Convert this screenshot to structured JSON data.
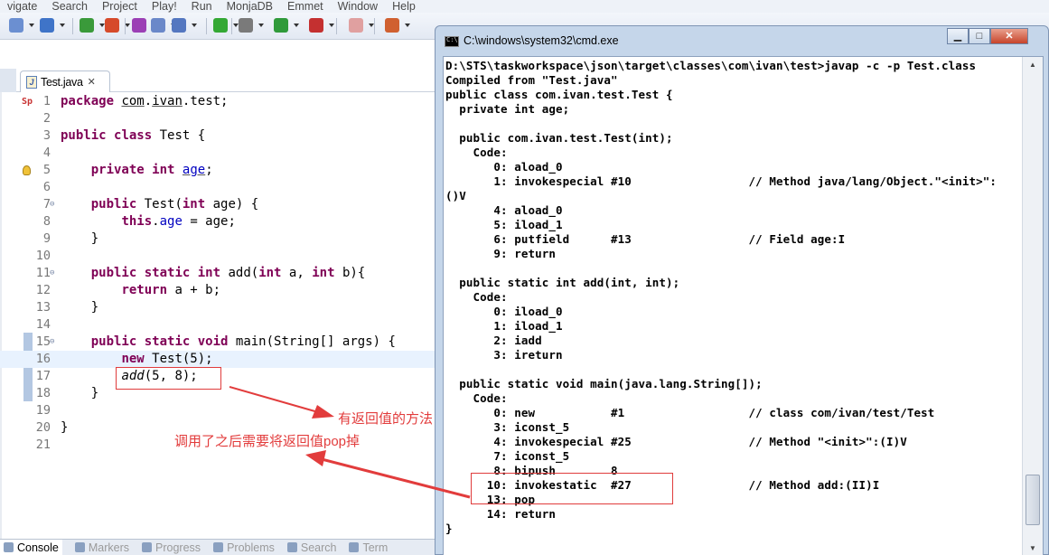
{
  "menu": [
    "vigate",
    "Search",
    "Project",
    "Play!",
    "Run",
    "MonjaDB",
    "Emmet",
    "Window",
    "Help"
  ],
  "editor": {
    "tab_label": "Test.java",
    "tab_close": "✕",
    "lines": [
      {
        "n": "1",
        "html": "<span class=\"kw\">package</span> <span class=\"ul\">com</span>.<span class=\"ul\">ivan</span>.test;"
      },
      {
        "n": "2",
        "html": ""
      },
      {
        "n": "3",
        "html": "<span class=\"kw\">public</span> <span class=\"kw\">class</span> Test {"
      },
      {
        "n": "4",
        "html": ""
      },
      {
        "n": "5",
        "html": "    <span class=\"kw\">private</span> <span class=\"kw\">int</span> <span class=\"fld ul\">age</span>;"
      },
      {
        "n": "6",
        "html": ""
      },
      {
        "n": "7",
        "html": "    <span class=\"kw\">public</span> Test(<span class=\"kw\">int</span> age) {"
      },
      {
        "n": "8",
        "html": "        <span class=\"kw\">this</span>.<span class=\"fld\">age</span> = age;"
      },
      {
        "n": "9",
        "html": "    }"
      },
      {
        "n": "10",
        "html": ""
      },
      {
        "n": "11",
        "html": "    <span class=\"kw\">public</span> <span class=\"kw\">static</span> <span class=\"kw\">int</span> add(<span class=\"kw\">int</span> a, <span class=\"kw\">int</span> b){"
      },
      {
        "n": "12",
        "html": "        <span class=\"kw\">return</span> a + b;"
      },
      {
        "n": "13",
        "html": "    }"
      },
      {
        "n": "14",
        "html": ""
      },
      {
        "n": "15",
        "html": "    <span class=\"kw\">public</span> <span class=\"kw\">static</span> <span class=\"kw\">void</span> main(String[] args) {"
      },
      {
        "n": "16",
        "html": "        <span class=\"kw\">new</span> Test(5);"
      },
      {
        "n": "17",
        "html": "        <span class=\"it\">add</span>(5, 8);"
      },
      {
        "n": "18",
        "html": "    }"
      },
      {
        "n": "19",
        "html": ""
      },
      {
        "n": "20",
        "html": "}"
      },
      {
        "n": "21",
        "html": ""
      }
    ],
    "marker_sp": "Sp"
  },
  "annotations": {
    "note_return": "有返回值的方法",
    "note_pop": "调用了之后需要将返回值pop掉",
    "accent_color": "#e23c3c"
  },
  "bottom_tabs": [
    "Console",
    "Markers",
    "Progress",
    "Problems",
    "Search",
    "Term"
  ],
  "cmd": {
    "title": "C:\\windows\\system32\\cmd.exe",
    "minimize": "▁",
    "maximize": "□",
    "close": "✕",
    "lines": [
      "D:\\STS\\taskworkspace\\json\\target\\classes\\com\\ivan\\test>javap -c -p Test.class",
      "Compiled from \"Test.java\"",
      "public class com.ivan.test.Test {",
      "  private int age;",
      "",
      "  public com.ivan.test.Test(int);",
      "    Code:",
      "       0: aload_0",
      "       1: invokespecial #10                 // Method java/lang/Object.\"<init>\":",
      "()V",
      "       4: aload_0",
      "       5: iload_1",
      "       6: putfield      #13                 // Field age:I",
      "       9: return",
      "",
      "  public static int add(int, int);",
      "    Code:",
      "       0: iload_0",
      "       1: iload_1",
      "       2: iadd",
      "       3: ireturn",
      "",
      "  public static void main(java.lang.String[]);",
      "    Code:",
      "       0: new           #1                  // class com/ivan/test/Test",
      "       3: iconst_5",
      "       4: invokespecial #25                 // Method \"<init>\":(I)V",
      "       7: iconst_5",
      "       8: bipush        8",
      "      10: invokestatic  #27                 // Method add:(II)I",
      "      13: pop",
      "      14: return",
      "}"
    ]
  }
}
